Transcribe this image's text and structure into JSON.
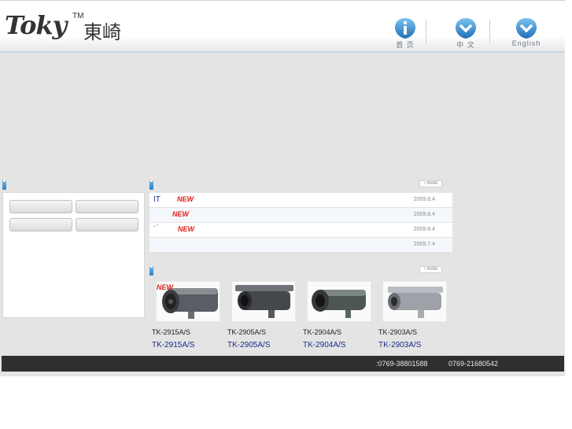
{
  "header": {
    "logo_text": "Toky",
    "logo_tm": "TM",
    "logo_cn": "東崎",
    "nav": [
      {
        "label": "首 页",
        "icon": "info-icon"
      },
      {
        "label": "中 文",
        "icon": "chevron-down-icon"
      },
      {
        "label": "English",
        "icon": "chevron-down-icon"
      }
    ]
  },
  "more_label": "› more",
  "news": [
    {
      "title": "IT",
      "badge": "NEW",
      "date": "2009.8.4"
    },
    {
      "title": "",
      "badge": "NEW",
      "date": "2009.8.4"
    },
    {
      "title": "- '",
      "badge": "NEW",
      "date": "2009.8.4"
    },
    {
      "title": "",
      "badge": "",
      "date": "2009.7.4"
    }
  ],
  "products": {
    "badge": "NEW",
    "items": [
      {
        "code": "TK-2915A/S",
        "link": "TK-2915A/S"
      },
      {
        "code": "TK-2905A/S",
        "link": "TK-2905A/S"
      },
      {
        "code": "TK-2904A/S",
        "link": "TK-2904A/S"
      },
      {
        "code": "TK-2903A/S",
        "link": "TK-2903A/S"
      }
    ]
  },
  "footer": {
    "phone1": ":0769-38801588",
    "phone2": "0769-21680542"
  },
  "colors": {
    "accent_blue": "#2a80c6",
    "new_red": "#e0201a",
    "link_blue": "#1a2a8a",
    "footer_bg": "#2f2f2f"
  }
}
